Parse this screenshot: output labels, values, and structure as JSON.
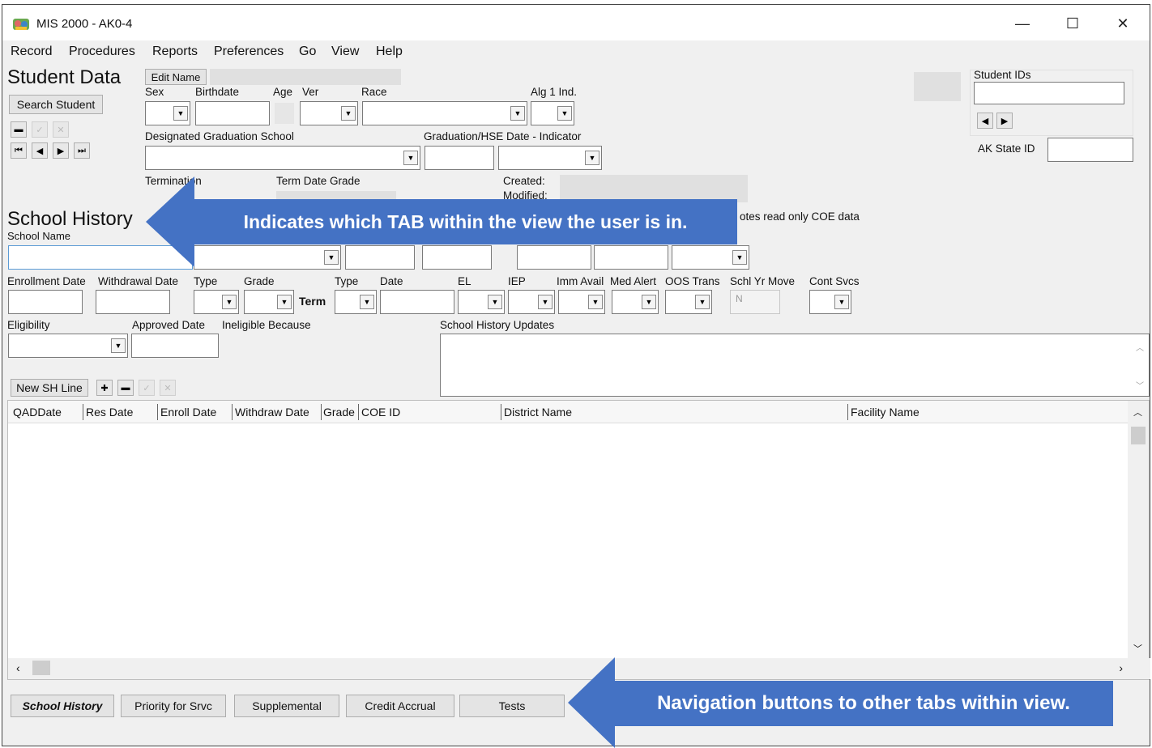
{
  "window": {
    "title": "MIS 2000 - AK0-4",
    "minimize": "—",
    "maximize": "☐",
    "close": "✕"
  },
  "menu": [
    "Record",
    "Procedures",
    "Reports",
    "Preferences",
    "Go",
    "View",
    "Help"
  ],
  "student": {
    "heading": "Student Data",
    "edit_name": "Edit Name",
    "search_student": "Search Student",
    "labels": {
      "sex": "Sex",
      "birthdate": "Birthdate",
      "age": "Age",
      "ver": "Ver",
      "race": "Race",
      "alg1": "Alg 1 Ind.",
      "grad_school": "Designated Graduation School",
      "grad_date": "Graduation/HSE Date - Indicator",
      "termination": "Termination",
      "term_date_grade": "Term Date Grade",
      "created": "Created:",
      "modified": "Modified:",
      "student_ids": "Student IDs",
      "ak_state_id": "AK State ID"
    }
  },
  "school_history": {
    "heading": "School History",
    "labels": {
      "school_name": "School Name",
      "read_only_note": "otes read only COE data",
      "enrollment_date": "Enrollment Date",
      "withdrawal_date": "Withdrawal Date",
      "type": "Type",
      "grade": "Grade",
      "term": "Term",
      "type2": "Type",
      "date": "Date",
      "el": "EL",
      "iep": "IEP",
      "imm_avail": "Imm Avail",
      "med_alert": "Med Alert",
      "oos_trans": "OOS Trans",
      "schl_yr_move": "Schl Yr Move",
      "cont_svcs": "Cont Svcs",
      "eligibility": "Eligibility",
      "approved_date": "Approved Date",
      "ineligible_because": "Ineligible Because",
      "updates": "School History Updates"
    },
    "schl_yr_move_value": "N",
    "new_sh_line": "New SH Line"
  },
  "grid": {
    "columns": [
      "QADDate",
      "Res Date",
      "Enroll Date",
      "Withdraw Date",
      "Grade",
      "COE ID",
      "District Name",
      "Facility Name"
    ]
  },
  "tabs": [
    "School History",
    "Priority for Srvc",
    "Supplemental",
    "Credit Accrual",
    "Tests"
  ],
  "callouts": {
    "tab_indicator": "Indicates which TAB within the view the user is in.",
    "nav_buttons": "Navigation buttons to other tabs within view."
  },
  "colors": {
    "callout": "#4472c4",
    "window_bg": "#f0f0f0"
  }
}
